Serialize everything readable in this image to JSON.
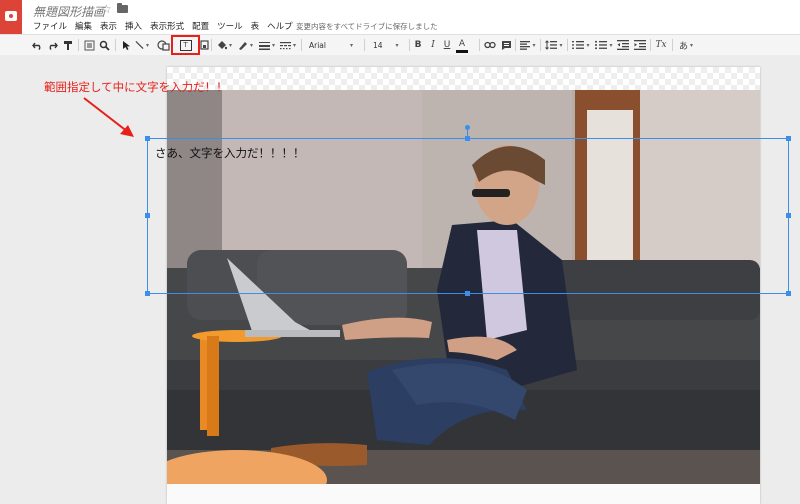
{
  "header": {
    "doc_title": "無題図形描画",
    "save_status": "変更内容をすべてドライブに保存しました",
    "menu": [
      "ファイル",
      "編集",
      "表示",
      "挿入",
      "表示形式",
      "配置",
      "ツール",
      "表",
      "ヘルプ"
    ]
  },
  "toolbar": {
    "font_name": "Arial",
    "font_size": "14",
    "bold": "B",
    "italic": "I",
    "underline": "U",
    "text_color": "A",
    "clear_format": "Tx",
    "input_tools": "あ",
    "text_box_icon": "T"
  },
  "canvas": {
    "annotation": "範囲指定して中に文字を入力だ！！",
    "textbox_text": "さあ、文字を入力だ！！！！"
  },
  "colors": {
    "accent_red": "#e8201a",
    "selection_blue": "#3d8ee8",
    "app_red": "#db4437"
  }
}
